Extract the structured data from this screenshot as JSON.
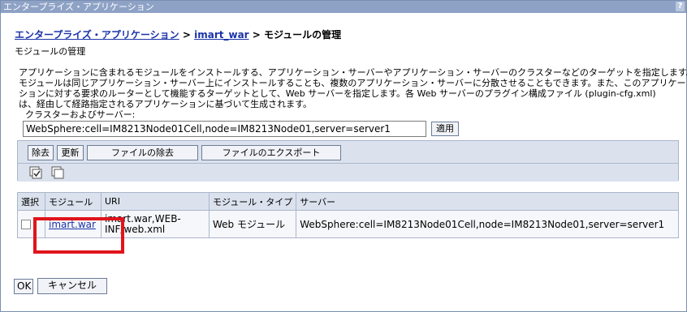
{
  "window": {
    "title": "エンタープライズ・アプリケーション",
    "help_label": "?"
  },
  "breadcrumb": {
    "item1": "エンタープライズ・アプリケーション",
    "sep1": " > ",
    "item2": "imart_war",
    "sep2": " > ",
    "current": "モジュールの管理"
  },
  "page": {
    "subtitle": "モジュールの管理",
    "description": [
      "アプリケーションに含まれるモジュールをインストールする、アプリケーション・サーバーやアプリケーション・サーバーのクラスターなどのターゲットを指定します。",
      "モジュールは同じアプリケーション・サーバー上にインストールすることも、複数のアプリケーション・サーバーに分散させることもできます。また、このアプリケー",
      "ションに対する要求のルーターとして機能するターゲットとして、Web サーバーを指定します。各 Web サーバーのプラグイン構成ファイル (plugin-cfg.xml)",
      "は、経由して経路指定されるアプリケーションに基づいて生成されます。"
    ]
  },
  "scope": {
    "label": "クラスターおよびサーバー:",
    "value": "WebSphere:cell=IM8213Node01Cell,node=IM8213Node01,server=server1",
    "apply_label": "適用"
  },
  "toolbar": {
    "remove_label": "除去",
    "update_label": "更新",
    "remove_file_label": "ファイルの除去",
    "export_file_label": "ファイルのエクスポート",
    "select_all_icon": "select-all-icon",
    "deselect_all_icon": "deselect-all-icon"
  },
  "table": {
    "headers": {
      "select": "選択",
      "module": "モジュール",
      "uri": "URI",
      "module_type": "モジュール・タイプ",
      "server": "サーバー"
    },
    "rows": [
      {
        "module": "imart.war",
        "uri_line1": "imart.war,WEB-",
        "uri_line2": "INF/web.xml",
        "module_type": "Web モジュール",
        "server": "WebSphere:cell=IM8213Node01Cell,node=IM8213Node01,server=server1"
      }
    ]
  },
  "footer": {
    "ok_label": "OK",
    "cancel_label": "キャンセル"
  },
  "colors": {
    "titlebar": "#8ea2c6",
    "link": "#1a33a8",
    "toolbar_bg": "#dbe2ee",
    "highlight": "#e0141c"
  }
}
